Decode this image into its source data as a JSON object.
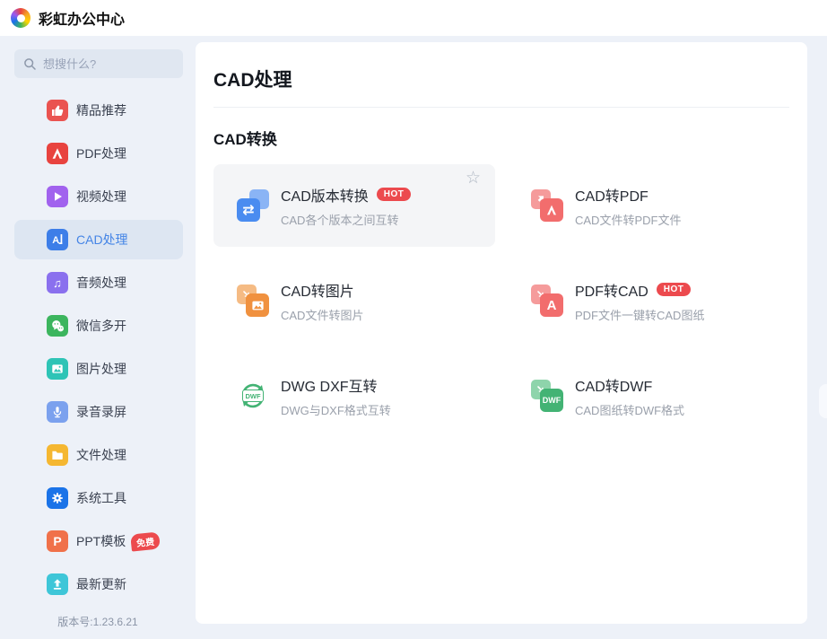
{
  "header": {
    "app_title": "彩虹办公中心"
  },
  "sidebar": {
    "search_placeholder": "想搜什么?",
    "items": [
      {
        "label": "精品推荐",
        "icon": "thumbs-up-icon",
        "color": "#ea5350"
      },
      {
        "label": "PDF处理",
        "icon": "pdf-icon",
        "color": "#e8433f"
      },
      {
        "label": "视频处理",
        "icon": "play-icon",
        "color": "#a162ee"
      },
      {
        "label": "CAD处理",
        "icon": "cad-text-icon",
        "color": "#3d7ee8",
        "selected": true
      },
      {
        "label": "音频处理",
        "icon": "music-note-icon",
        "color": "#8a70ee"
      },
      {
        "label": "微信多开",
        "icon": "wechat-icon",
        "color": "#3cb55e"
      },
      {
        "label": "图片处理",
        "icon": "image-icon",
        "color": "#2ec4b6"
      },
      {
        "label": "录音录屏",
        "icon": "microphone-icon",
        "color": "#7ba1ee"
      },
      {
        "label": "文件处理",
        "icon": "folder-icon",
        "color": "#f5b731"
      },
      {
        "label": "系统工具",
        "icon": "gear-icon",
        "color": "#1a73e8"
      },
      {
        "label": "PPT模板",
        "icon": "ppt-icon",
        "color": "#f0714a",
        "badge": "免费"
      },
      {
        "label": "最新更新",
        "icon": "upload-icon",
        "color": "#3ec6d8"
      }
    ],
    "version": "版本号:1.23.6.21"
  },
  "main": {
    "page_title": "CAD处理",
    "section_title": "CAD转换",
    "cards": [
      {
        "title": "CAD版本转换",
        "subtitle": "CAD各个版本之间互转",
        "hot": "HOT",
        "icon": "cad-version-convert-icon",
        "color": "#4a8cf0"
      },
      {
        "title": "CAD转PDF",
        "subtitle": "CAD文件转PDF文件",
        "icon": "cad-to-pdf-icon",
        "color": "#f26d6d"
      },
      {
        "title": "CAD转图片",
        "subtitle": "CAD文件转图片",
        "icon": "cad-to-image-icon",
        "color": "#f0913f"
      },
      {
        "title": "PDF转CAD",
        "subtitle": "PDF文件一键转CAD图纸",
        "hot": "HOT",
        "icon": "pdf-to-cad-icon",
        "color": "#f26d6d"
      },
      {
        "title": "DWG DXF互转",
        "subtitle": "DWG与DXF格式互转",
        "icon": "dwg-dxf-swap-icon",
        "color": "#43b374"
      },
      {
        "title": "CAD转DWF",
        "subtitle": "CAD图纸转DWF格式",
        "icon": "cad-to-dwf-icon",
        "color": "#43b374"
      }
    ]
  }
}
